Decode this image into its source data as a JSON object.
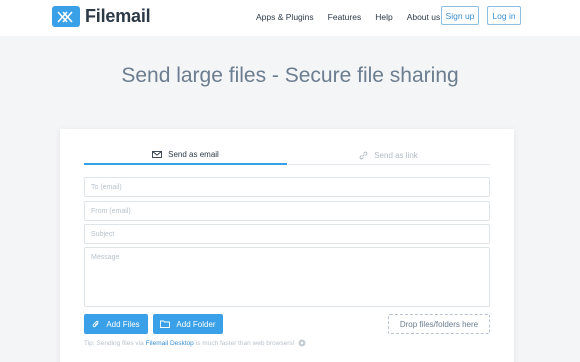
{
  "header": {
    "brand": "Filemail",
    "nav": [
      "Apps & Plugins",
      "Features",
      "Help",
      "About us"
    ],
    "signup_label": "Sign up",
    "login_label": "Log in"
  },
  "hero": {
    "title": "Send large files - Secure file sharing"
  },
  "tabs": {
    "email_label": "Send as email",
    "link_label": "Send as link"
  },
  "form": {
    "to_placeholder": "To (email)",
    "from_placeholder": "From (email)",
    "subject_placeholder": "Subject",
    "message_placeholder": "Message"
  },
  "actions": {
    "add_files_label": "Add Files",
    "add_folder_label": "Add Folder",
    "drop_label": "Drop files/folders here"
  },
  "tip": {
    "prefix": "Tip: Sending files via",
    "link": "Filemail Desktop",
    "suffix": "is much faster than web browsers!"
  },
  "colors": {
    "accent": "#3aa0e8",
    "text": "#2c3a48",
    "muted": "#b8c2cc"
  },
  "icons": [
    "logo-icon",
    "envelope-icon",
    "link-icon",
    "paperclip-icon",
    "folder-icon",
    "info-icon"
  ]
}
